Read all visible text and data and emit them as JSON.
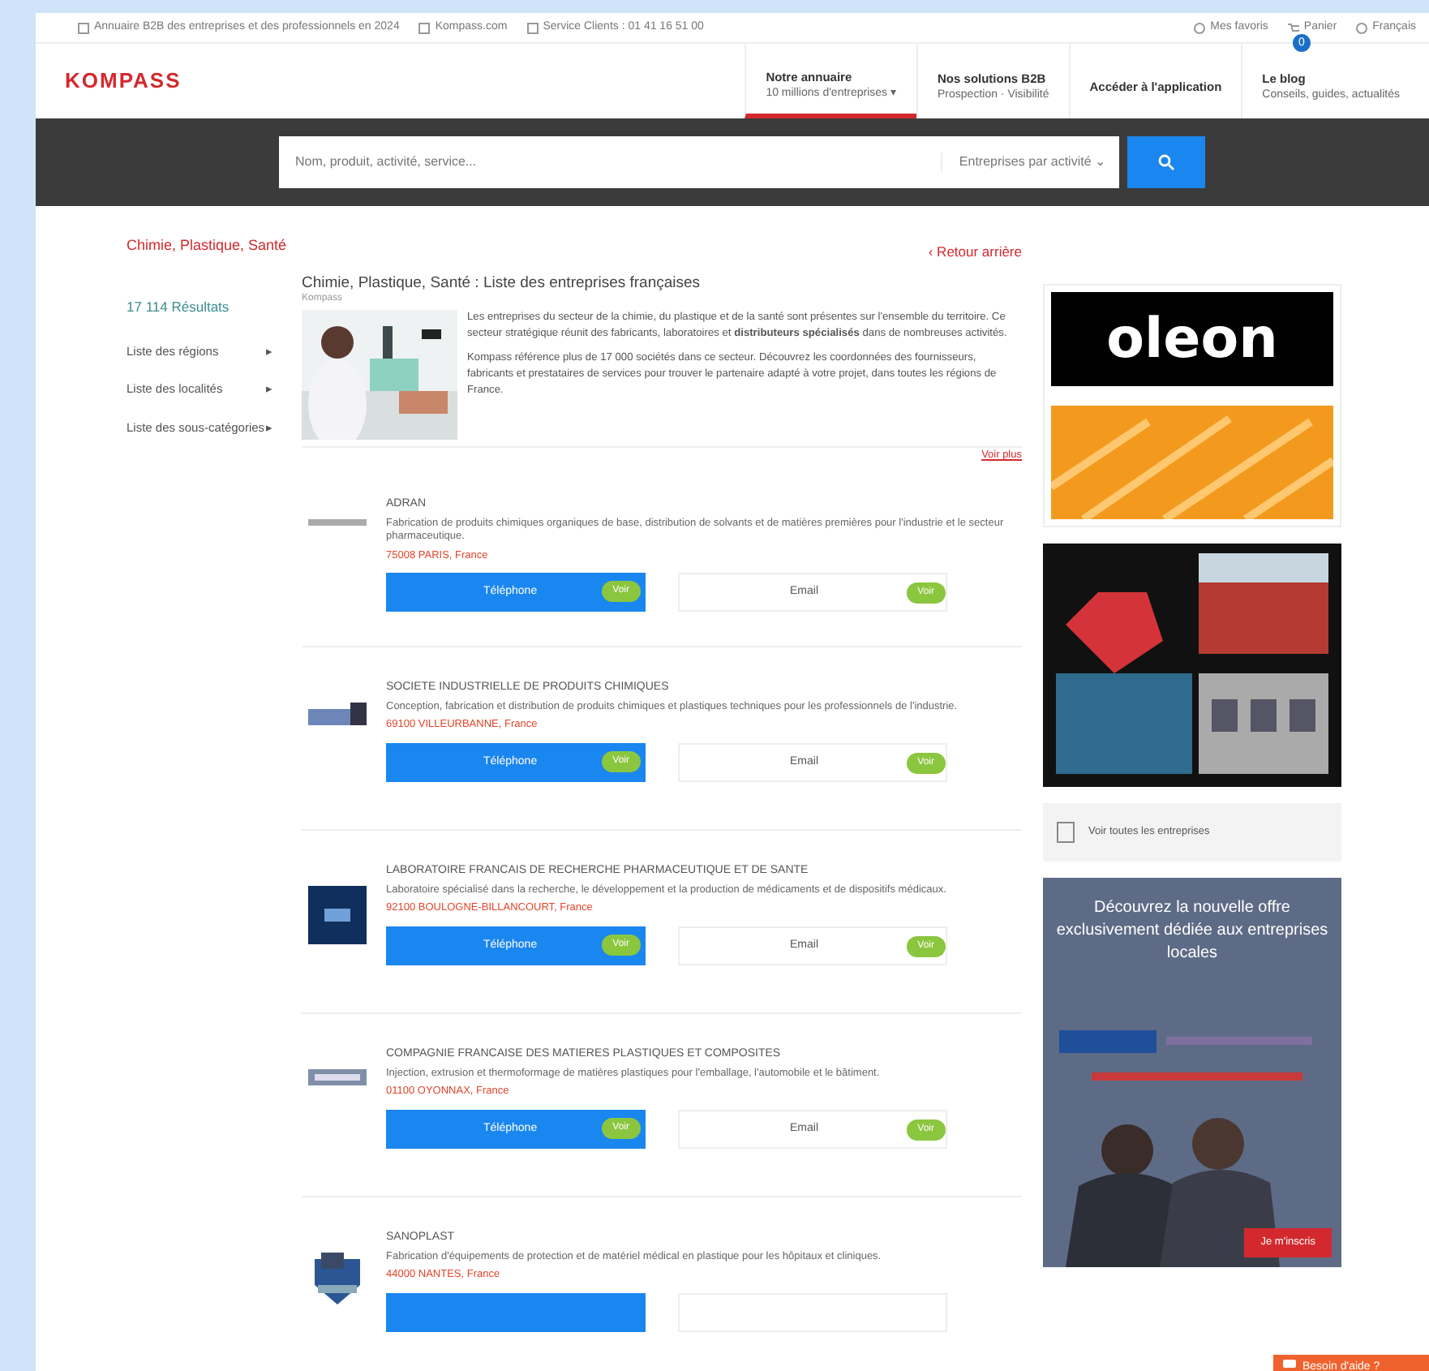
{
  "top_bar": {
    "left": [
      {
        "text": "Annuaire B2B des entreprises et des professionnels en 2024"
      },
      {
        "text": "Kompass.com"
      },
      {
        "text": "Service Clients : 01 41 16 51 00"
      }
    ],
    "right": [
      {
        "text": "Mes favoris"
      },
      {
        "text": "Panier",
        "badge": "0"
      },
      {
        "text": "Français"
      }
    ]
  },
  "header": {
    "logo": "KOMPASS",
    "nav": [
      {
        "title": "Notre annuaire",
        "subtitle": "10 millions d'entreprises ▾",
        "selected": true
      },
      {
        "title": "Nos solutions B2B",
        "subtitle": "Prospection · Visibilité",
        "selected": false
      },
      {
        "title": "Accéder à l'application",
        "selected": false
      },
      {
        "title": "Le blog",
        "subtitle": "Conseils, guides, actualités",
        "selected": false
      }
    ]
  },
  "search": {
    "placeholder": "Nom, produit, activité, service...",
    "scope": "Entreprises par activité ⌄"
  },
  "breadcrumb": "Chimie, Plastique, Santé",
  "back_link": "‹ Retour arrière",
  "sidebar": {
    "results": "17 114 Résultats",
    "items": [
      {
        "label": "Liste des régions",
        "arrow": "▸"
      },
      {
        "label": "Liste des localités",
        "arrow": "▸"
      },
      {
        "label": "Liste des sous-catégories",
        "arrow": "▸"
      }
    ]
  },
  "intro": {
    "title": "Chimie, Plastique, Santé : Liste des entreprises françaises",
    "byline": "Kompass",
    "paragraphs": [
      "Les entreprises du secteur de la chimie, du plastique et de la santé sont présentes sur l'ensemble du territoire. Ce secteur stratégique réunit des fabricants, laboratoires et **distributeurs spécialisés** dans de nombreuses activités.",
      "Kompass référence plus de 17 000 sociétés dans ce secteur. Découvrez les coordonnées des fournisseurs, fabricants et prestataires de services pour trouver le partenaire adapté à votre projet, dans toutes les régions de France."
    ],
    "more": "Voir plus"
  },
  "listings": [
    {
      "kind": "text",
      "name": "ADRAN",
      "description": "Fabrication de produits chimiques organiques de base, distribution de solvants et de matières premières pour l'industrie et le secteur pharmaceutique.",
      "location": "75008 PARIS, France",
      "phone": "Téléphone",
      "phone_reveal": "Voir",
      "email": "Email",
      "email_reveal": "Voir"
    },
    {
      "kind": "card",
      "name": "SOCIETE INDUSTRIELLE DE PRODUITS CHIMIQUES",
      "description": "Conception, fabrication et distribution de produits chimiques et plastiques techniques pour les professionnels de l'industrie.",
      "location": "69100 VILLEURBANNE, France",
      "phone": "Téléphone",
      "phone_reveal": "Voir",
      "email": "Email",
      "email_reveal": "Voir"
    },
    {
      "kind": "square",
      "name": "LABORATOIRE FRANCAIS DE RECHERCHE PHARMACEUTIQUE ET DE SANTE",
      "description": "Laboratoire spécialisé dans la recherche, le développement et la production de médicaments et de dispositifs médicaux.",
      "location": "92100 BOULOGNE-BILLANCOURT, France",
      "phone": "Téléphone",
      "phone_reveal": "Voir",
      "email": "Email",
      "email_reveal": "Voir"
    },
    {
      "kind": "banner",
      "name": "COMPAGNIE FRANCAISE DES MATIERES PLASTIQUES ET COMPOSITES",
      "description": "Injection, extrusion et thermoformage de matières plastiques pour l'emballage, l'automobile et le bâtiment.",
      "location": "01100 OYONNAX, France",
      "phone": "Téléphone",
      "phone_reveal": "Voir",
      "email": "Email",
      "email_reveal": "Voir"
    },
    {
      "kind": "badge",
      "name": "SANOPLAST",
      "description": "Fabrication d'équipements de protection et de matériel médical en plastique pour les hôpitaux et cliniques.",
      "location": "44000 NANTES, France"
    }
  ],
  "ads": [
    {
      "kind": "brand",
      "brand": "oleon"
    },
    {
      "kind": "picture"
    },
    {
      "kind": "link",
      "text": "Voir toutes les entreprises"
    },
    {
      "kind": "promo",
      "headline": "Découvrez la nouvelle offre exclusivement dédiée aux entreprises locales",
      "cta": "Je m'inscris"
    }
  ],
  "chat": {
    "text": "Besoin d'aide ?"
  }
}
